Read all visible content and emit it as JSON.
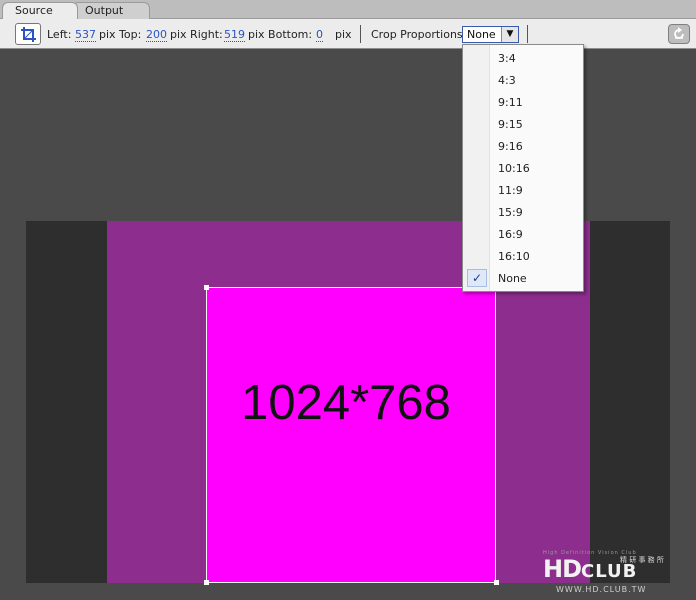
{
  "tabs": [
    {
      "label": "Source",
      "active": true
    },
    {
      "label": "Output",
      "active": false
    }
  ],
  "toolbar": {
    "crop_icon": "crop-icon",
    "left_label": "Left:",
    "left_value": "537",
    "top_label": "pix  Top:",
    "top_value": "200",
    "right_label": "pix  Right:",
    "right_value": "519",
    "bottom_label": "pix  Bottom:",
    "bottom_value": "0",
    "bottom_unit": "pix",
    "crop_proportions_label": "Crop Proportions:",
    "crop_proportions_value": "None",
    "dropdown_arrow": "▼",
    "right_button_icon": "reset-icon"
  },
  "dropdown": {
    "items": [
      {
        "label": "3:4",
        "selected": false
      },
      {
        "label": "4:3",
        "selected": false
      },
      {
        "label": "9:11",
        "selected": false
      },
      {
        "label": "9:15",
        "selected": false
      },
      {
        "label": "9:16",
        "selected": false
      },
      {
        "label": "10:16",
        "selected": false
      },
      {
        "label": "11:9",
        "selected": false
      },
      {
        "label": "15:9",
        "selected": false
      },
      {
        "label": "16:9",
        "selected": false
      },
      {
        "label": "16:10",
        "selected": false
      },
      {
        "label": "None",
        "selected": true
      }
    ],
    "check_mark": "✓"
  },
  "canvas": {
    "image_text": "1024*768"
  },
  "watermark": {
    "tagline": "High Definition Vision Club",
    "cjk": "精 研 事 務 所",
    "logo_hd": "HD",
    "logo_club": "CLUB",
    "url": "WWW.HD.CLUB.TW"
  },
  "colors": {
    "background": "#4a4a4a",
    "image_fill": "#8d2d8e",
    "crop_fill": "#ff00ff",
    "accent_blue": "#2b53c4"
  }
}
